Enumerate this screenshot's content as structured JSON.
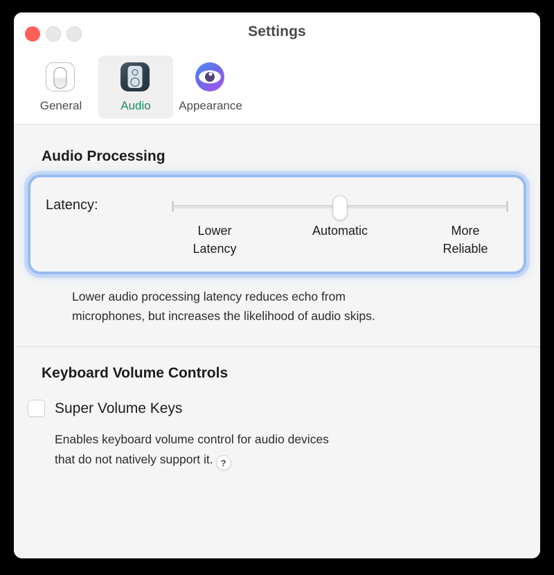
{
  "window": {
    "title": "Settings",
    "traffic_lights": {
      "close_color": "#ff5f57",
      "minimize_color": "#e8e8e8",
      "zoom_color": "#e8e8e8"
    }
  },
  "toolbar": {
    "tabs": [
      {
        "label": "General",
        "icon": "toggle-switch-icon",
        "selected": false
      },
      {
        "label": "Audio",
        "icon": "speaker-icon",
        "selected": true
      },
      {
        "label": "Appearance",
        "icon": "eye-icon",
        "selected": false
      }
    ],
    "selected_tab_text_color": "#1b8a5f"
  },
  "audio_processing": {
    "heading": "Audio Processing",
    "slider": {
      "label": "Latency:",
      "value": "Automatic",
      "position_percent": 50,
      "scale_labels": {
        "low": "Lower\nLatency",
        "low_line1": "Lower",
        "low_line2": "Latency",
        "mid": "Automatic",
        "high_line1": "More",
        "high_line2": "Reliable"
      },
      "focused": true,
      "focus_ring_color": "#96b9f0"
    },
    "description_line1": "Lower audio processing latency reduces echo from",
    "description_line2": "microphones, but increases the likelihood of audio skips."
  },
  "keyboard_volume_controls": {
    "heading": "Keyboard Volume Controls",
    "checkbox": {
      "label": "Super Volume Keys",
      "checked": false
    },
    "description_line1": "Enables keyboard volume control for audio devices",
    "description_line2": "that do not natively support it.",
    "help_button_label": "?"
  }
}
